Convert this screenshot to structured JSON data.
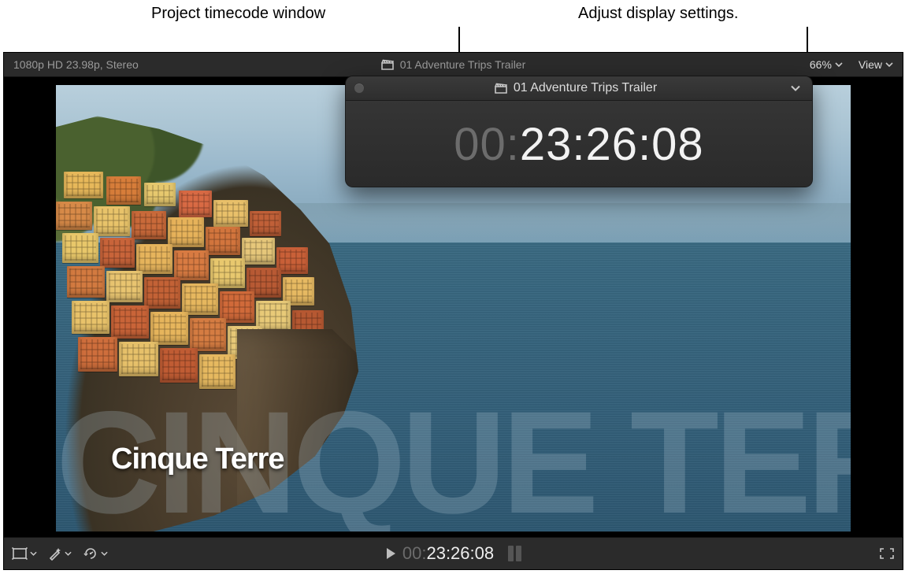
{
  "callouts": {
    "timecode_window": "Project timecode window",
    "display_settings": "Adjust display settings."
  },
  "viewer": {
    "format_info": "1080p HD 23.98p, Stereo",
    "project_title": "01 Adventure Trips Trailer",
    "zoom_label": "66%",
    "view_menu_label": "View"
  },
  "scene": {
    "big_title": "CINQUE TERRE",
    "small_title": "Cinque Terre"
  },
  "timecode_window": {
    "title": "01 Adventure Trips Trailer",
    "tc_dim_prefix": "00:",
    "tc_value": "23:26:08"
  },
  "transport": {
    "tc_dim_prefix": "00:",
    "tc_value": "23:26:08"
  },
  "icons": {
    "clapper": "clapperboard-icon",
    "chevron_down": "chevron-down-icon",
    "crop": "transform-icon",
    "wand": "enhance-icon",
    "retime": "retime-icon",
    "play": "play-icon",
    "fullscreen": "fullscreen-icon"
  },
  "houses": [
    {
      "l": 10,
      "t": 0,
      "w": 50,
      "h": 34,
      "c": "#e7b85a"
    },
    {
      "l": 64,
      "t": 6,
      "w": 44,
      "h": 36,
      "c": "#d77d3a"
    },
    {
      "l": 112,
      "t": 14,
      "w": 40,
      "h": 30,
      "c": "#e6c86e"
    },
    {
      "l": 156,
      "t": 24,
      "w": 42,
      "h": 34,
      "c": "#d86a44"
    },
    {
      "l": 200,
      "t": 36,
      "w": 44,
      "h": 34,
      "c": "#e9c06a"
    },
    {
      "l": 246,
      "t": 50,
      "w": 40,
      "h": 32,
      "c": "#c06038"
    },
    {
      "l": 0,
      "t": 38,
      "w": 46,
      "h": 36,
      "c": "#d78a48"
    },
    {
      "l": 48,
      "t": 44,
      "w": 46,
      "h": 38,
      "c": "#e8c36a"
    },
    {
      "l": 96,
      "t": 50,
      "w": 44,
      "h": 36,
      "c": "#c96a3a"
    },
    {
      "l": 142,
      "t": 58,
      "w": 46,
      "h": 38,
      "c": "#e6b25a"
    },
    {
      "l": 190,
      "t": 70,
      "w": 44,
      "h": 36,
      "c": "#d2753d"
    },
    {
      "l": 236,
      "t": 84,
      "w": 42,
      "h": 34,
      "c": "#e6c77a"
    },
    {
      "l": 280,
      "t": 96,
      "w": 40,
      "h": 34,
      "c": "#c96038"
    },
    {
      "l": 8,
      "t": 78,
      "w": 46,
      "h": 38,
      "c": "#e8c76a"
    },
    {
      "l": 56,
      "t": 84,
      "w": 44,
      "h": 38,
      "c": "#c8643a"
    },
    {
      "l": 102,
      "t": 92,
      "w": 46,
      "h": 38,
      "c": "#e6b45c"
    },
    {
      "l": 150,
      "t": 100,
      "w": 44,
      "h": 38,
      "c": "#d87b42"
    },
    {
      "l": 196,
      "t": 110,
      "w": 44,
      "h": 38,
      "c": "#e8c86e"
    },
    {
      "l": 242,
      "t": 122,
      "w": 44,
      "h": 38,
      "c": "#b85a34"
    },
    {
      "l": 288,
      "t": 134,
      "w": 40,
      "h": 36,
      "c": "#e6b962"
    },
    {
      "l": 14,
      "t": 120,
      "w": 48,
      "h": 40,
      "c": "#d27a40"
    },
    {
      "l": 64,
      "t": 126,
      "w": 46,
      "h": 40,
      "c": "#e8c470"
    },
    {
      "l": 112,
      "t": 134,
      "w": 46,
      "h": 40,
      "c": "#c36236"
    },
    {
      "l": 160,
      "t": 142,
      "w": 46,
      "h": 40,
      "c": "#e6b75e"
    },
    {
      "l": 208,
      "t": 152,
      "w": 44,
      "h": 40,
      "c": "#d06a3a"
    },
    {
      "l": 254,
      "t": 164,
      "w": 44,
      "h": 40,
      "c": "#e8ca78"
    },
    {
      "l": 300,
      "t": 176,
      "w": 40,
      "h": 38,
      "c": "#b65832"
    },
    {
      "l": 20,
      "t": 164,
      "w": 48,
      "h": 42,
      "c": "#e8c26a"
    },
    {
      "l": 70,
      "t": 170,
      "w": 48,
      "h": 42,
      "c": "#c96438"
    },
    {
      "l": 120,
      "t": 178,
      "w": 48,
      "h": 42,
      "c": "#e6b55c"
    },
    {
      "l": 170,
      "t": 186,
      "w": 46,
      "h": 42,
      "c": "#d57c42"
    },
    {
      "l": 218,
      "t": 196,
      "w": 44,
      "h": 42,
      "c": "#e8c978"
    },
    {
      "l": 264,
      "t": 208,
      "w": 42,
      "h": 40,
      "c": "#b25530"
    },
    {
      "l": 28,
      "t": 210,
      "w": 50,
      "h": 44,
      "c": "#ce6e3c"
    },
    {
      "l": 80,
      "t": 216,
      "w": 50,
      "h": 44,
      "c": "#e6c06a"
    },
    {
      "l": 132,
      "t": 224,
      "w": 48,
      "h": 44,
      "c": "#c05c34"
    },
    {
      "l": 182,
      "t": 232,
      "w": 46,
      "h": 44,
      "c": "#e6b960"
    },
    {
      "l": 230,
      "t": 244,
      "w": 42,
      "h": 42,
      "c": "#d07240"
    }
  ]
}
